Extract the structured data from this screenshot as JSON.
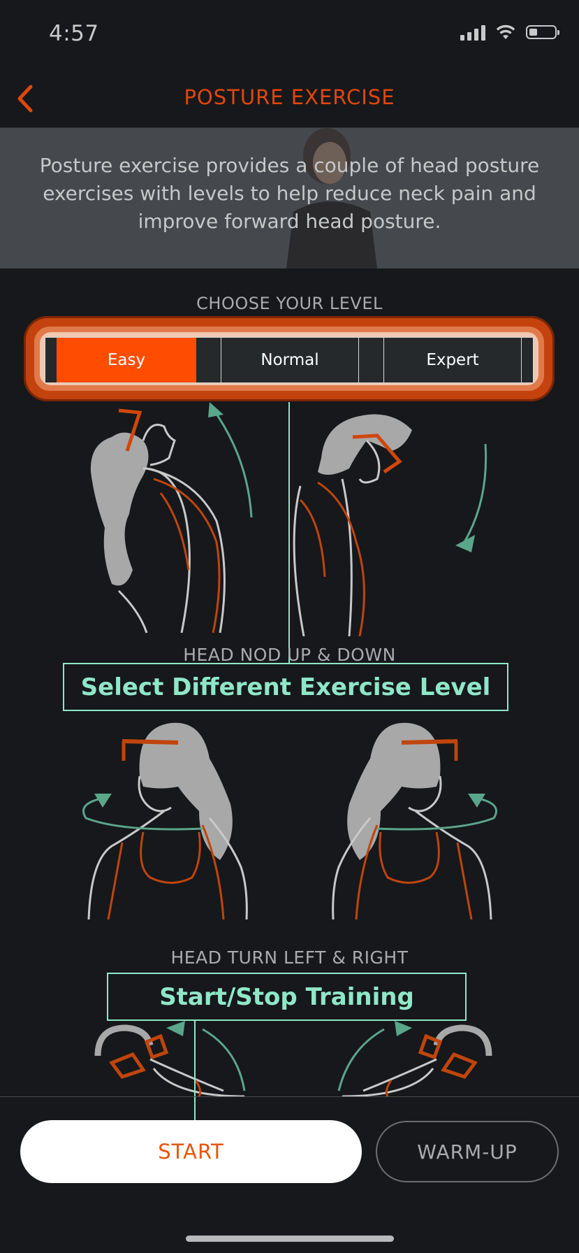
{
  "status": {
    "time": "4:57"
  },
  "header": {
    "title": "POSTURE EXERCISE"
  },
  "banner": {
    "text": "Posture exercise provides a couple of head posture exercises with levels to help reduce neck pain and improve forward head posture."
  },
  "level": {
    "heading": "CHOOSE YOUR LEVEL",
    "options": [
      "Easy",
      "Normal",
      "Expert"
    ],
    "selected": "Easy"
  },
  "exercises": [
    {
      "label": "HEAD NOD UP & DOWN"
    },
    {
      "label": "HEAD TURN LEFT & RIGHT"
    }
  ],
  "annotations": {
    "level_callout": "Select Different Exercise Level",
    "start_callout": "Start/Stop Training"
  },
  "actions": {
    "start": "START",
    "warmup": "WARM-UP"
  },
  "colors": {
    "accent": "#e1470b",
    "callout": "#8fe7c7",
    "arrow": "#5aa68a",
    "figure": "#a8a8a8"
  }
}
